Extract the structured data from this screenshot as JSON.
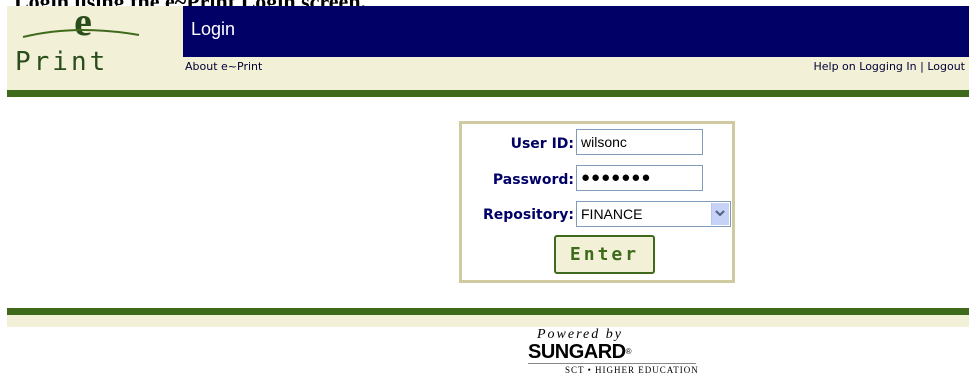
{
  "caption": "Login using the e~Print Login screen.",
  "header": {
    "logo_letter": "e",
    "logo_word": "Print",
    "title": "Login",
    "nav": {
      "about": "About e~Print",
      "help": "Help on Logging In",
      "separator": "|",
      "logout": "Logout"
    }
  },
  "login_form": {
    "user_id_label": "User ID:",
    "user_id_value": "wilsonc",
    "password_label": "Password:",
    "password_masked": "●●●●●●●",
    "repository_label": "Repository:",
    "repository_value": "FINANCE",
    "enter_label": "Enter"
  },
  "footer": {
    "powered_by": "Powered by",
    "brand": "SUNGARD",
    "brand_mark": "®",
    "division": "SCT • HIGHER EDUCATION"
  },
  "colors": {
    "title_bar": "#000066",
    "accent_green": "#3f6a1c",
    "cream": "#f3f0d8",
    "label_navy": "#000066"
  }
}
